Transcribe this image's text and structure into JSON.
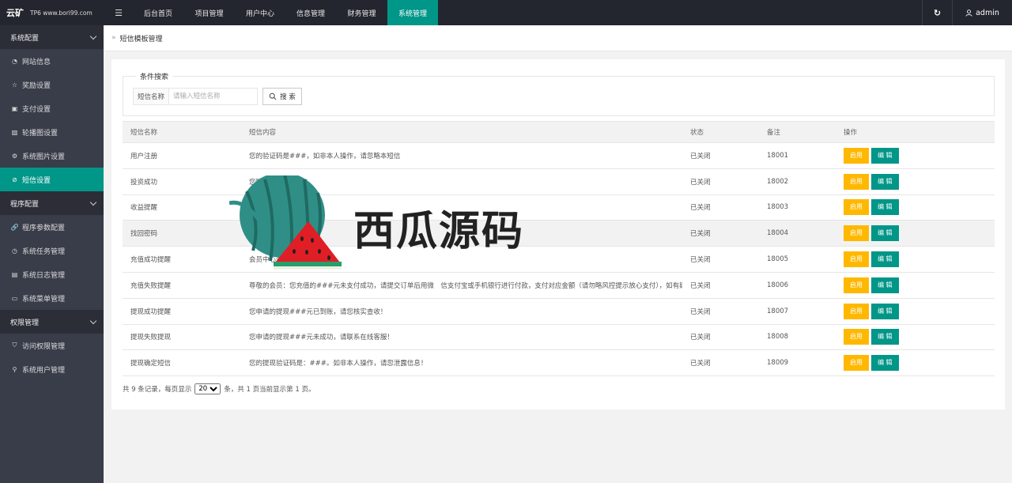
{
  "header": {
    "logo_main": "云矿",
    "logo_sub": "TP6 www.bori99.com",
    "nav": [
      "后台首页",
      "项目管理",
      "用户中心",
      "信息管理",
      "财务管理",
      "系统管理"
    ],
    "active_nav": "系统管理",
    "user_name": "admin"
  },
  "sidebar": {
    "groups": [
      {
        "label": "系统配置",
        "items": [
          "网站信息",
          "奖励设置",
          "支付设置",
          "轮播图设置",
          "系统图片设置",
          "短信设置"
        ]
      },
      {
        "label": "程序配置",
        "items": [
          "程序参数配置",
          "系统任务管理",
          "系统日志管理",
          "系统菜单管理"
        ]
      },
      {
        "label": "权限管理",
        "items": [
          "访问权限管理",
          "系统用户管理"
        ]
      }
    ],
    "active_item": "短信设置"
  },
  "breadcrumb": {
    "current": "短信模板管理"
  },
  "search": {
    "legend": "条件搜索",
    "label": "短信名称",
    "placeholder": "请输入短信名称",
    "button": "搜 索"
  },
  "table": {
    "headers": [
      "短信名称",
      "短信内容",
      "状态",
      "备注",
      "操作"
    ],
    "rows": [
      {
        "name": "用户注册",
        "content": "您的验证码是###，如非本人操作，请忽略本短信",
        "status": "已关闭",
        "remark": "18001"
      },
      {
        "name": "投资成功",
        "content": "您购买 项目已成功！",
        "status": "已关闭",
        "remark": "18002"
      },
      {
        "name": "收益提醒",
        "content": "",
        "status": "已关闭",
        "remark": "18003"
      },
      {
        "name": "找回密码",
        "content": "",
        "status": "已关闭",
        "remark": "18004"
      },
      {
        "name": "充值成功提醒",
        "content": "会员中心查收！",
        "status": "已关闭",
        "remark": "18005"
      },
      {
        "name": "充值失败提醒",
        "content": "尊敬的会员：您充值的###元未支付成功，请提交订单后用微　信支付宝或手机银行进行付款，支付对应金额（请勿略风控提示放心支付），如有疑问，请",
        "status": "已关闭",
        "remark": "18006"
      },
      {
        "name": "提现成功提醒",
        "content": "您申请的提现###元已到账，请您核实查收！",
        "status": "已关闭",
        "remark": "18007"
      },
      {
        "name": "提现失败提现",
        "content": "您申请的提现###元未成功，请联系在线客服！",
        "status": "已关闭",
        "remark": "18008"
      },
      {
        "name": "提现确定短信",
        "content": "您的提现验证码是：###。如非本人操作，请忽泄露信息！",
        "status": "已关闭",
        "remark": "18009"
      }
    ],
    "enable_label": "启用",
    "edit_label": "编 辑"
  },
  "pager": {
    "prefix": "共 9 条记录，每页显示",
    "page_size": "20",
    "suffix": "条，共 1 页当前显示第 1 页。"
  },
  "watermark": {
    "text": "西瓜源码"
  },
  "colors": {
    "accent": "#009688",
    "enable": "#ffb800",
    "closed": "#e03c3c",
    "topbar": "#23262e",
    "sidebar": "#393d49"
  }
}
